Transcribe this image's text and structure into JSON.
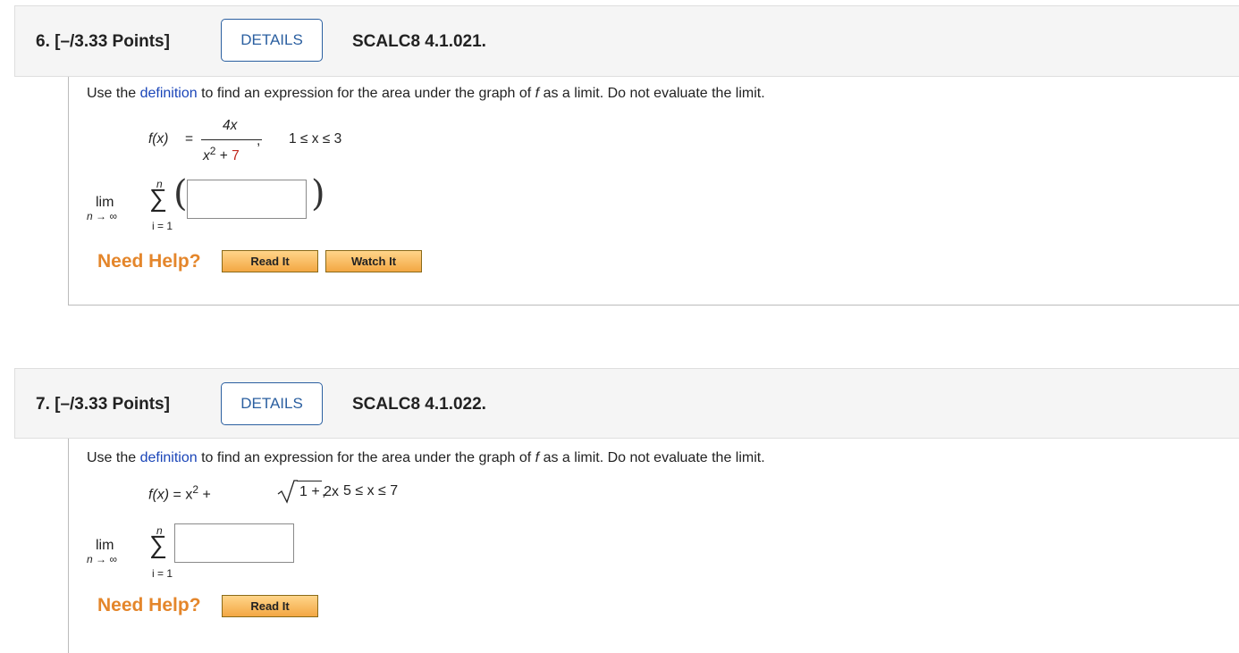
{
  "q6": {
    "number": "6.  [–/3.33 Points]",
    "details_label": "DETAILS",
    "code": "SCALC8 4.1.021.",
    "prompt_pre": "Use the ",
    "prompt_link": "definition",
    "prompt_mid": " to find an expression for the area under the graph of ",
    "prompt_f": "f",
    "prompt_post": " as a limit. Do not evaluate the limit.",
    "fx_label": "f(x)",
    "eq": "=",
    "numerator": "4x",
    "denominator_x": "x",
    "denominator_exp": "2",
    "denominator_plus": " + ",
    "denominator_const": "7",
    "comma": ",",
    "interval": "1 ≤ x ≤ 3",
    "lim": "lim",
    "lim_sub": "n → ∞",
    "sum_top": "n",
    "sum_bottom": "i = 1",
    "answer_value": "",
    "need_help": "Need Help?",
    "read_it": "Read It",
    "watch_it": "Watch It"
  },
  "q7": {
    "number": "7.  [–/3.33 Points]",
    "details_label": "DETAILS",
    "code": "SCALC8 4.1.022.",
    "prompt_pre": "Use the ",
    "prompt_link": "definition",
    "prompt_mid": " to find an expression for the area under the graph of ",
    "prompt_f": "f",
    "prompt_post": " as a limit. Do not evaluate the limit.",
    "fx_label": "f(x)",
    "eq_part": " = x",
    "exp": "2",
    "plus": " + ",
    "sqrt_content": "1 + 2x",
    "comma": ",",
    "interval": "5 ≤ x ≤ 7",
    "lim": "lim",
    "lim_sub": "n → ∞",
    "sum_top": "n",
    "sum_bottom": "i = 1",
    "answer_value": "",
    "need_help": "Need Help?",
    "read_it": "Read It"
  }
}
